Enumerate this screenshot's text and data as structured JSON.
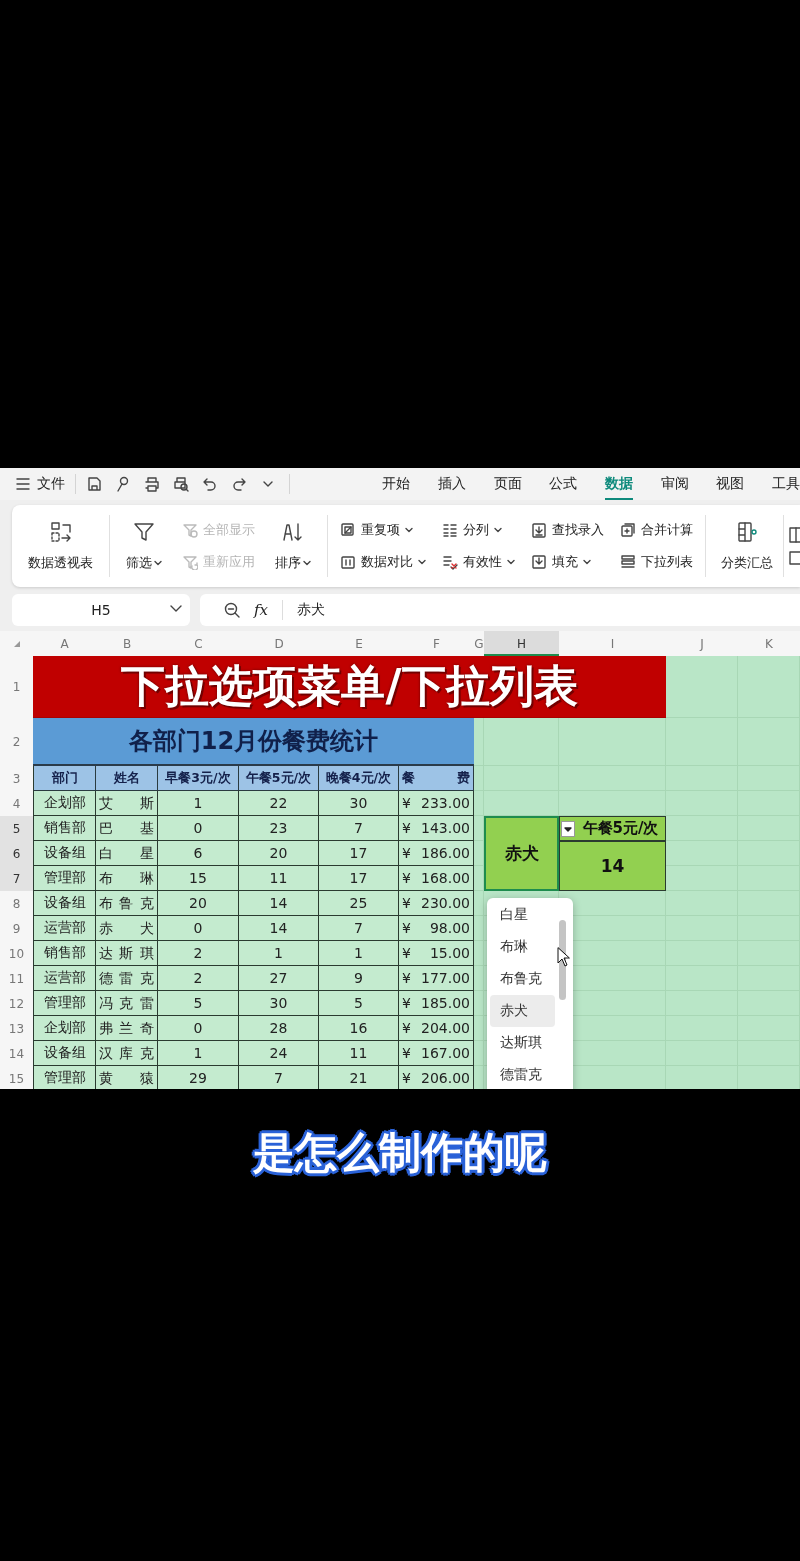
{
  "menu_bar": {
    "file_label": "文件",
    "tabs": [
      {
        "label": "开始",
        "selected": false
      },
      {
        "label": "插入",
        "selected": false
      },
      {
        "label": "页面",
        "selected": false
      },
      {
        "label": "公式",
        "selected": false
      },
      {
        "label": "数据",
        "selected": true
      },
      {
        "label": "审阅",
        "selected": false
      },
      {
        "label": "视图",
        "selected": false
      },
      {
        "label": "工具",
        "selected": false
      }
    ]
  },
  "ribbon": {
    "groups": [
      [
        {
          "kind": "large",
          "label": "数据透视表",
          "dropdown": false,
          "disabled": false
        }
      ],
      [
        {
          "kind": "large",
          "label": "筛选",
          "dropdown": true,
          "disabled": false
        },
        {
          "kind": "stack",
          "items": [
            {
              "label": "全部显示",
              "dropdown": false,
              "disabled": true
            },
            {
              "label": "重新应用",
              "dropdown": false,
              "disabled": true
            }
          ]
        },
        {
          "kind": "large",
          "label": "排序",
          "dropdown": true,
          "disabled": false
        }
      ],
      [
        {
          "kind": "stack",
          "items": [
            {
              "label": "重复项",
              "dropdown": true,
              "disabled": false
            },
            {
              "label": "数据对比",
              "dropdown": true,
              "disabled": false
            }
          ]
        },
        {
          "kind": "stack",
          "items": [
            {
              "label": "分列",
              "dropdown": true,
              "disabled": false
            },
            {
              "label": "有效性",
              "dropdown": true,
              "disabled": false
            }
          ]
        },
        {
          "kind": "stack",
          "items": [
            {
              "label": "查找录入",
              "dropdown": false,
              "disabled": false
            },
            {
              "label": "填充",
              "dropdown": true,
              "disabled": false
            }
          ]
        },
        {
          "kind": "stack",
          "items": [
            {
              "label": "合并计算",
              "dropdown": false,
              "disabled": false
            },
            {
              "label": "下拉列表",
              "dropdown": false,
              "disabled": false
            }
          ]
        }
      ],
      [
        {
          "kind": "large",
          "label": "分类汇总",
          "dropdown": false,
          "disabled": false
        }
      ]
    ]
  },
  "formula_bar": {
    "cell_ref": "H5",
    "function_label": "fx",
    "value": "赤犬"
  },
  "sheet": {
    "column_headers": [
      {
        "label": "A",
        "selected": false
      },
      {
        "label": "B",
        "selected": false
      },
      {
        "label": "C",
        "selected": false
      },
      {
        "label": "D",
        "selected": false
      },
      {
        "label": "E",
        "selected": false
      },
      {
        "label": "F",
        "selected": false
      },
      {
        "label": "G",
        "selected": false
      },
      {
        "label": "H",
        "selected": true
      },
      {
        "label": "I",
        "selected": false
      },
      {
        "label": "J",
        "selected": false
      },
      {
        "label": "K",
        "selected": false
      }
    ],
    "row_headers": [
      {
        "label": "1",
        "selected": false
      },
      {
        "label": "2",
        "selected": false
      },
      {
        "label": "3",
        "selected": false
      },
      {
        "label": "4",
        "selected": false
      },
      {
        "label": "5",
        "selected": true
      },
      {
        "label": "6",
        "selected": true
      },
      {
        "label": "7",
        "selected": true
      },
      {
        "label": "8",
        "selected": false
      },
      {
        "label": "9",
        "selected": false
      },
      {
        "label": "10",
        "selected": false
      },
      {
        "label": "11",
        "selected": false
      },
      {
        "label": "12",
        "selected": false
      },
      {
        "label": "13",
        "selected": false
      },
      {
        "label": "14",
        "selected": false
      },
      {
        "label": "15",
        "selected": false
      }
    ],
    "title": "下拉选项菜单/下拉列表",
    "subtitle": "各部门12月份餐费统计",
    "table_columns": [
      "部门",
      "姓名",
      "早餐3元/次",
      "午餐5元/次",
      "晚餐4元/次",
      "餐 费"
    ],
    "table_rows": [
      [
        "企划部",
        "艾 斯",
        "1",
        "22",
        "30",
        "¥ 233.00"
      ],
      [
        "销售部",
        "巴 基",
        "0",
        "23",
        "7",
        "¥ 143.00"
      ],
      [
        "设备组",
        "白 星",
        "6",
        "20",
        "17",
        "¥ 186.00"
      ],
      [
        "管理部",
        "布 琳",
        "15",
        "11",
        "17",
        "¥ 168.00"
      ],
      [
        "设备组",
        "布 鲁 克",
        "20",
        "14",
        "25",
        "¥ 230.00"
      ],
      [
        "运营部",
        "赤 犬",
        "0",
        "14",
        "7",
        "¥ 98.00"
      ],
      [
        "销售部",
        "达 斯 琪",
        "2",
        "1",
        "1",
        "¥ 15.00"
      ],
      [
        "运营部",
        "德 雷 克",
        "2",
        "27",
        "9",
        "¥ 177.00"
      ],
      [
        "管理部",
        "冯 克 雷",
        "5",
        "30",
        "5",
        "¥ 185.00"
      ],
      [
        "企划部",
        "弗 兰 奇",
        "0",
        "28",
        "16",
        "¥ 204.00"
      ],
      [
        "设备组",
        "汉 库 克",
        "1",
        "24",
        "11",
        "¥ 167.00"
      ],
      [
        "管理部",
        "黄 猿",
        "29",
        "7",
        "21",
        "¥ 206.00"
      ]
    ],
    "lookup": {
      "name": "赤犬",
      "header": "午餐5元/次",
      "result": "14"
    },
    "dropdown": {
      "items": [
        {
          "label": "白星",
          "selected": false
        },
        {
          "label": "布琳",
          "selected": false
        },
        {
          "label": "布鲁克",
          "selected": false
        },
        {
          "label": "赤犬",
          "selected": true
        },
        {
          "label": "达斯琪",
          "selected": false
        },
        {
          "label": "德雷克",
          "selected": false
        }
      ]
    }
  },
  "caption": "是怎么制作的呢"
}
